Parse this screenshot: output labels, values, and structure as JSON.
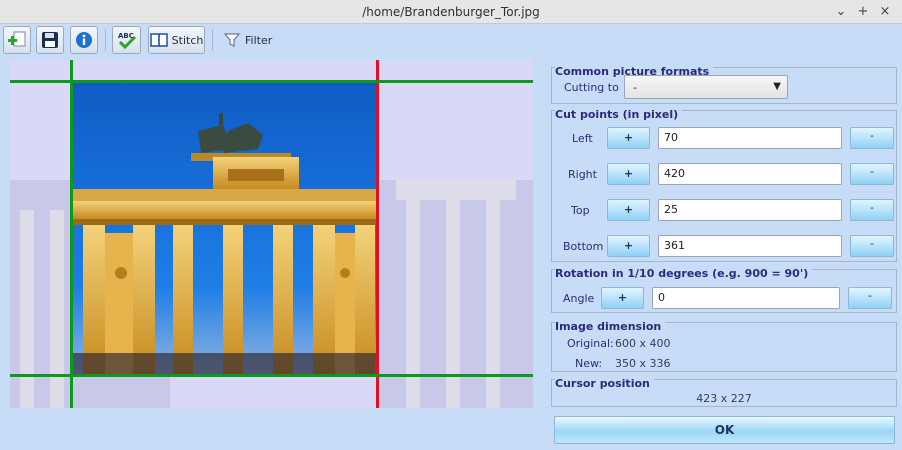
{
  "window": {
    "title": "/home/Brandenburger_Tor.jpg",
    "minimize_glyph": "⌄",
    "maximize_glyph": "+",
    "close_glyph": "×"
  },
  "toolbar": {
    "add_icon": "add-image-icon",
    "save_icon": "floppy-disk-icon",
    "info_icon": "info-icon",
    "spellcheck_icon": "abc-check-icon",
    "stitch_label": "Stitch",
    "filter_label": "Filter"
  },
  "image": {
    "colors": {
      "sky": "#1a6fd0",
      "gate": "#e0a12a",
      "crop_left_top_bottom": "#0a9a1c",
      "crop_right": "#e0102a"
    }
  },
  "common_formats": {
    "title": "Common picture formats",
    "cutting_to_label": "Cutting to",
    "cutting_to_value": "-"
  },
  "cut_points": {
    "title": "Cut points (in pixel)",
    "rows": [
      {
        "label": "Left",
        "plus": "+",
        "value": "70",
        "minus": "-"
      },
      {
        "label": "Right",
        "plus": "+",
        "value": "420",
        "minus": "-"
      },
      {
        "label": "Top",
        "plus": "+",
        "value": "25",
        "minus": "-"
      },
      {
        "label": "Bottom",
        "plus": "+",
        "value": "361",
        "minus": "-"
      }
    ]
  },
  "rotation": {
    "title": "Rotation in 1/10 degrees (e.g. 900 = 90')",
    "angle_label": "Angle",
    "plus": "+",
    "value": "0",
    "minus": "-"
  },
  "dimension": {
    "title": "Image dimension",
    "original_label": "Original:",
    "original_value": "600 x 400",
    "new_label": "New:",
    "new_value": "350 x 336"
  },
  "cursor": {
    "title": "Cursor position",
    "value": "423 x 227"
  },
  "ok_label": "OK"
}
